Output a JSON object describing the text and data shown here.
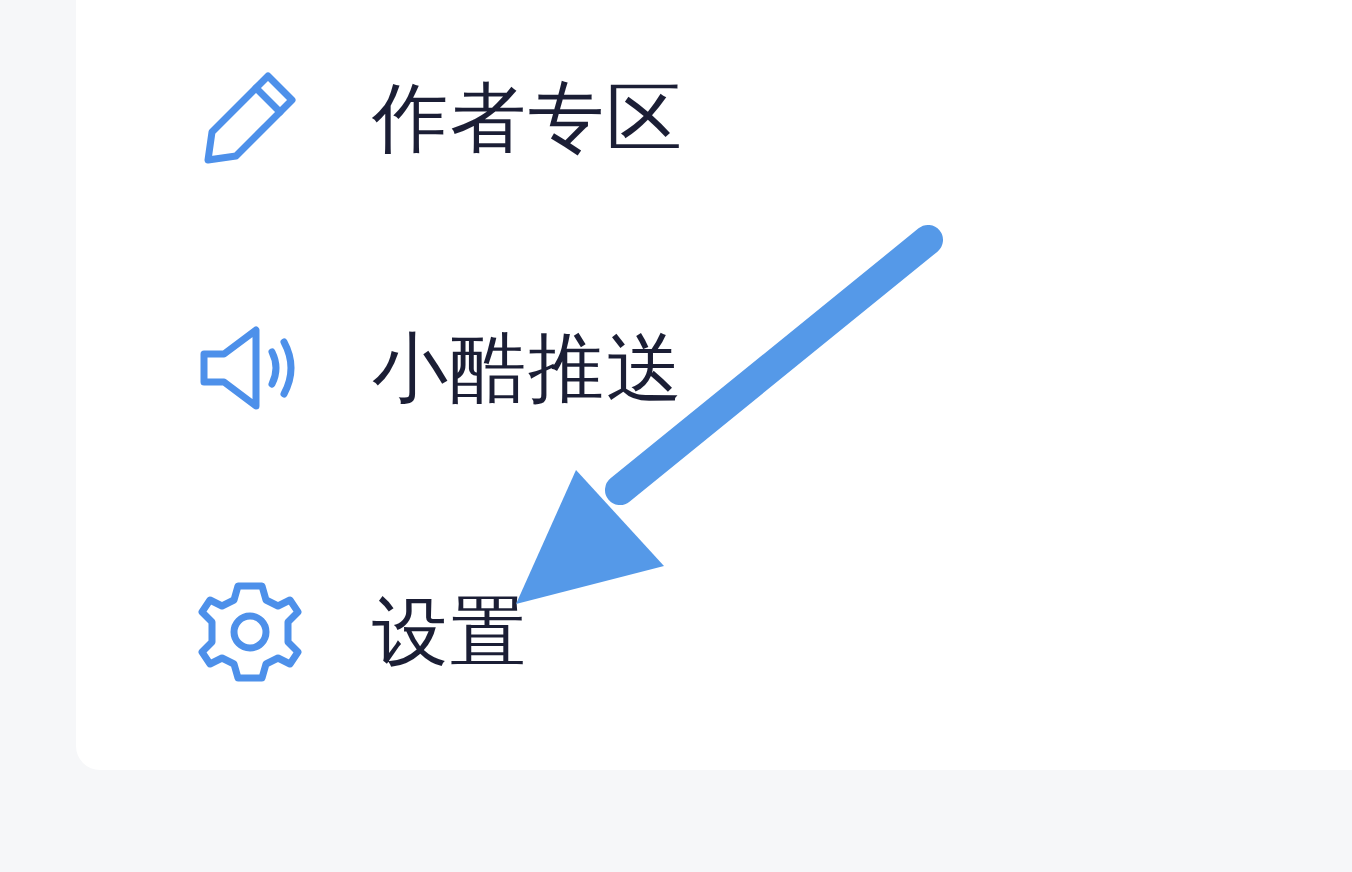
{
  "menu": {
    "items": [
      {
        "label": "作者专区",
        "kind": "pencil"
      },
      {
        "label": "小酷推送",
        "kind": "speaker"
      },
      {
        "label": "设置",
        "kind": "gear"
      }
    ]
  }
}
